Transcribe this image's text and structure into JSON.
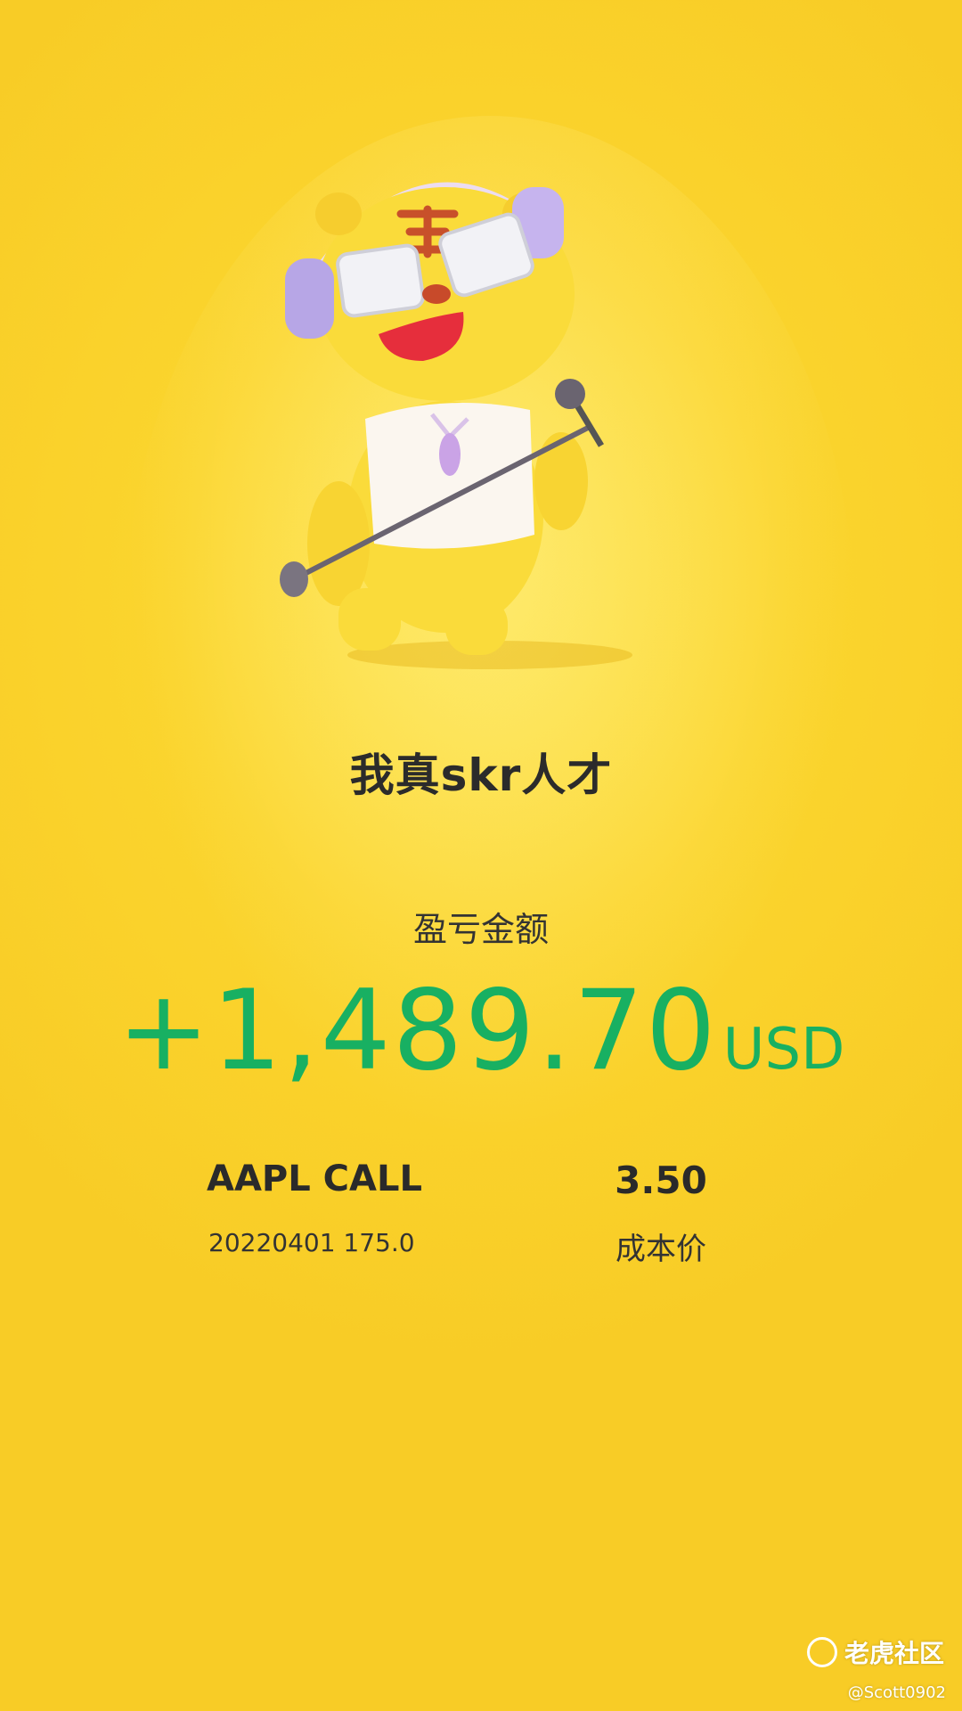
{
  "title": "我真skr人才",
  "pnl": {
    "label": "盈亏金额",
    "amount": "+1,489.70",
    "currency": "USD",
    "color": "#18b062"
  },
  "position": {
    "contract": "AAPL CALL",
    "detail": "20220401 175.0",
    "cost_value": "3.50",
    "cost_label": "成本价"
  },
  "watermark": {
    "brand": "老虎社区",
    "handle": "@Scott0902",
    "icon": "tiger-community-icon"
  },
  "mascot_icon": "tiger-mascot-with-headphones-and-microphone"
}
